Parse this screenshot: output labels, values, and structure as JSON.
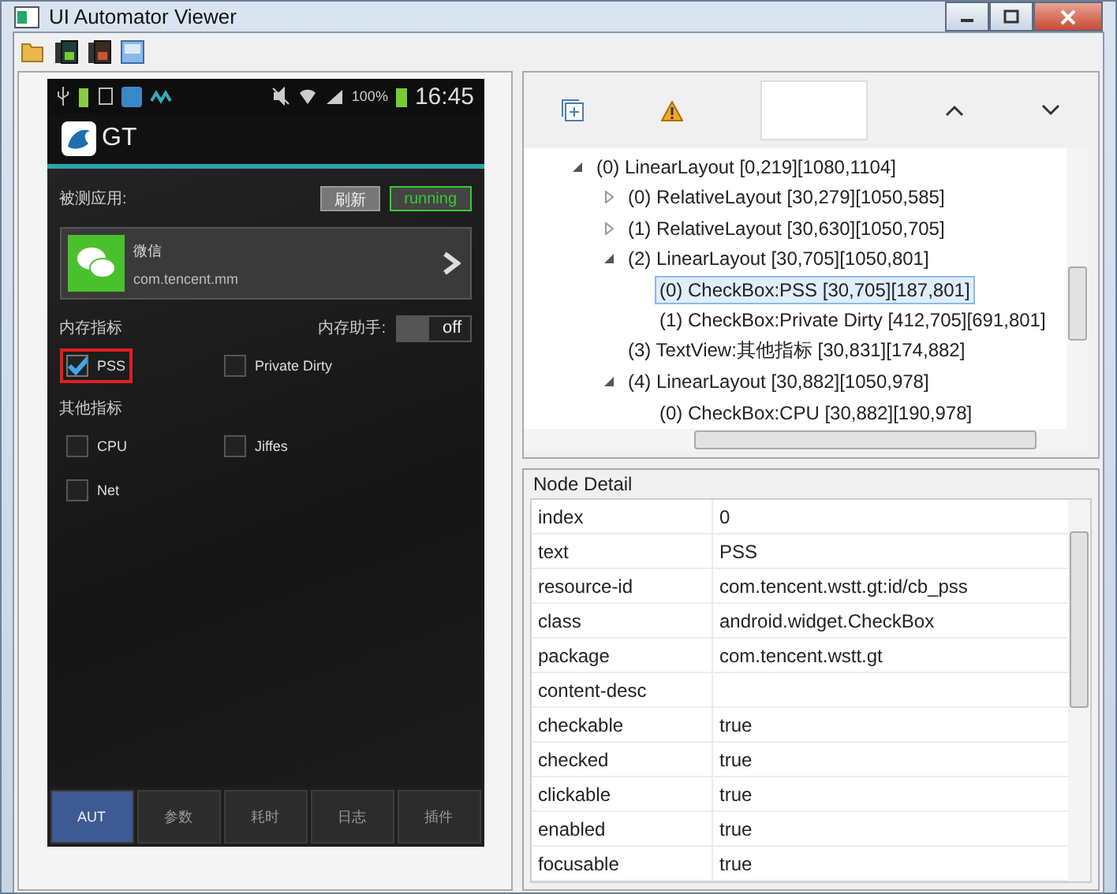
{
  "window": {
    "title": "UI Automator Viewer"
  },
  "phone": {
    "status_bar": {
      "battery_text": "100%",
      "time": "16:45"
    },
    "app_bar": {
      "title": "GT"
    },
    "app_label": "被测应用:",
    "buttons": [
      {
        "label": "刷新",
        "kind": "plain"
      },
      {
        "label": "running",
        "kind": "status"
      }
    ],
    "app_card": {
      "name": "微信",
      "package": "com.tencent.mm"
    },
    "memory_label": "内存指标",
    "helper_label": "内存助手:",
    "helper_toggle": {
      "label": "off",
      "on": false
    },
    "memory_checks": [
      {
        "label": "PSS",
        "checked": true,
        "highlighted": true
      },
      {
        "label": "Private Dirty",
        "checked": false,
        "highlighted": false
      }
    ],
    "other_label": "其他指标",
    "other_checks": [
      {
        "label": "CPU",
        "checked": false,
        "highlighted": false
      },
      {
        "label": "Jiffes",
        "checked": false,
        "highlighted": false
      },
      {
        "label": "Net",
        "checked": false,
        "highlighted": false
      }
    ],
    "bottom_tabs": [
      {
        "label": "AUT",
        "selected": true
      },
      {
        "label": "参数",
        "selected": false
      },
      {
        "label": "耗时",
        "selected": false
      },
      {
        "label": "日志",
        "selected": false
      },
      {
        "label": "插件",
        "selected": false
      }
    ]
  },
  "tree": [
    {
      "label": "(0) LinearLayout [0,219][1080,1104]",
      "kind": "branch",
      "expanded": true,
      "selected": false,
      "children": [
        {
          "label": "(0) RelativeLayout [30,279][1050,585]",
          "kind": "branch",
          "expanded": false,
          "selected": false
        },
        {
          "label": "(1) RelativeLayout [30,630][1050,705]",
          "kind": "branch",
          "expanded": false,
          "selected": false
        },
        {
          "label": "(2) LinearLayout [30,705][1050,801]",
          "kind": "branch",
          "expanded": true,
          "selected": false,
          "children": [
            {
              "label": "(0) CheckBox:PSS [30,705][187,801]",
              "kind": "leaf",
              "selected": true
            },
            {
              "label": "(1) CheckBox:Private Dirty [412,705][691,801]",
              "kind": "leaf",
              "selected": false
            }
          ]
        },
        {
          "label": "(3) TextView:其他指标 [30,831][174,882]",
          "kind": "leaf",
          "selected": false
        },
        {
          "label": "(4) LinearLayout [30,882][1050,978]",
          "kind": "branch",
          "expanded": true,
          "selected": false,
          "children": [
            {
              "label": "(0) CheckBox:CPU [30,882][190,978]",
              "kind": "leaf",
              "selected": false
            }
          ]
        }
      ]
    }
  ],
  "node_detail": {
    "title": "Node Detail",
    "rows": [
      {
        "key": "index",
        "value": "0"
      },
      {
        "key": "text",
        "value": "PSS"
      },
      {
        "key": "resource-id",
        "value": "com.tencent.wstt.gt:id/cb_pss"
      },
      {
        "key": "class",
        "value": "android.widget.CheckBox"
      },
      {
        "key": "package",
        "value": "com.tencent.wstt.gt"
      },
      {
        "key": "content-desc"
      },
      {
        "key": "checkable",
        "value": "true"
      },
      {
        "key": "checked",
        "value": "true"
      },
      {
        "key": "clickable",
        "value": "true"
      },
      {
        "key": "enabled",
        "value": "true"
      },
      {
        "key": "focusable",
        "value": "true"
      }
    ]
  }
}
